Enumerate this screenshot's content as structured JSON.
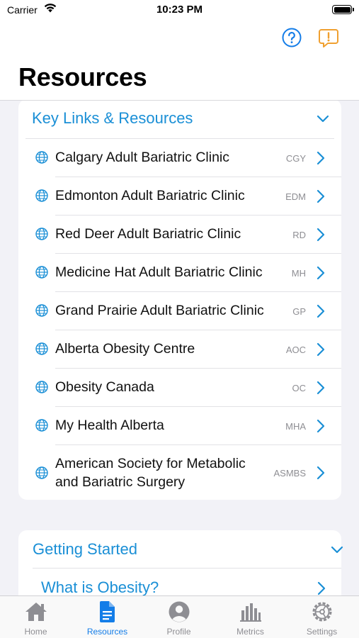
{
  "status_bar": {
    "carrier": "Carrier",
    "time": "10:23 PM"
  },
  "header": {
    "title": "Resources",
    "help_icon": "question-circle-icon",
    "alert_icon": "exclamation-bubble-icon"
  },
  "key_links": {
    "title": "Key Links & Resources",
    "items": [
      {
        "label": "Calgary Adult Bariatric Clinic",
        "code": "CGY"
      },
      {
        "label": "Edmonton Adult Bariatric Clinic",
        "code": "EDM"
      },
      {
        "label": "Red Deer Adult Bariatric Clinic",
        "code": "RD"
      },
      {
        "label": "Medicine Hat Adult Bariatric Clinic",
        "code": "MH"
      },
      {
        "label": "Grand Prairie Adult Bariatric Clinic",
        "code": "GP"
      },
      {
        "label": "Alberta Obesity Centre",
        "code": "AOC"
      },
      {
        "label": "Obesity Canada",
        "code": "OC"
      },
      {
        "label": "My Health Alberta",
        "code": "MHA"
      },
      {
        "label": "American Society for Metabolic and Bariatric Surgery",
        "code": "ASMBS"
      }
    ]
  },
  "getting_started": {
    "title": "Getting Started",
    "items": [
      {
        "label": "What is Obesity?"
      }
    ]
  },
  "tabs": [
    {
      "label": "Home",
      "icon": "house-icon",
      "active": false
    },
    {
      "label": "Resources",
      "icon": "document-icon",
      "active": true
    },
    {
      "label": "Profile",
      "icon": "person-circle-icon",
      "active": false
    },
    {
      "label": "Metrics",
      "icon": "bar-chart-icon",
      "active": false
    },
    {
      "label": "Settings",
      "icon": "gear-icon",
      "active": false
    }
  ],
  "colors": {
    "accent": "#1a8fd6",
    "alert": "#f0a030",
    "tab_active": "#147de8",
    "tab_inactive": "#8e8e93"
  }
}
